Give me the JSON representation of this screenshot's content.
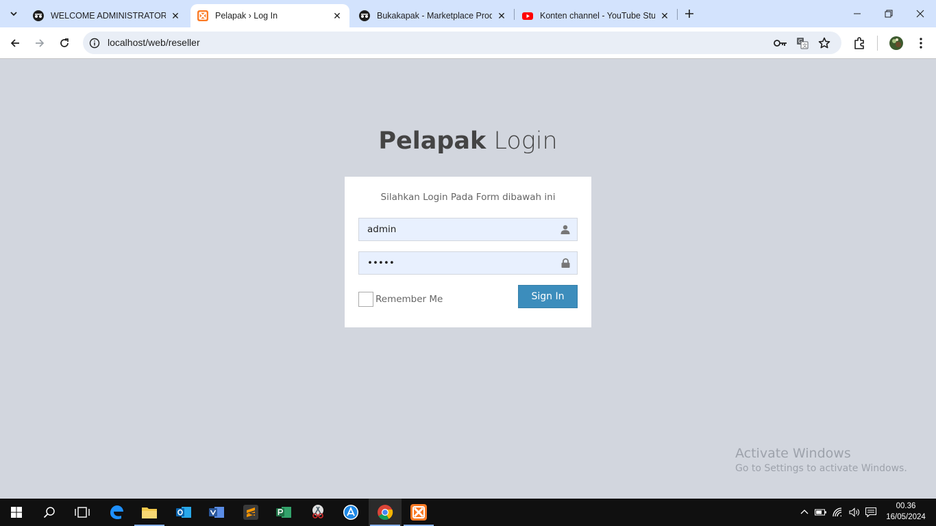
{
  "browser": {
    "tabs": [
      {
        "title": "WELCOME ADMINISTRATOR",
        "icon": "spy-icon",
        "active": false
      },
      {
        "title": "Pelapak › Log In",
        "icon": "xampp-icon",
        "active": true
      },
      {
        "title": "Bukakapak - Marketplace Produ",
        "icon": "spy-icon",
        "active": false
      },
      {
        "title": "Konten channel - YouTube Stud",
        "icon": "youtube-icon",
        "active": false
      }
    ],
    "url": "localhost/web/reseller"
  },
  "page": {
    "logo_bold": "Pelapak",
    "logo_light": "Login",
    "login_message": "Silahkan Login Pada Form dibawah ini",
    "username_value": "admin",
    "password_value": "admin",
    "remember_label": "Remember Me",
    "signin_label": "Sign In"
  },
  "watermark": {
    "line1": "Activate Windows",
    "line2": "Go to Settings to activate Windows."
  },
  "taskbar": {
    "time": "00.36",
    "date": "16/05/2024"
  },
  "colors": {
    "page_bg": "#d2d6de",
    "accent": "#3c8dbc",
    "tabstrip": "#d3e3fd"
  }
}
